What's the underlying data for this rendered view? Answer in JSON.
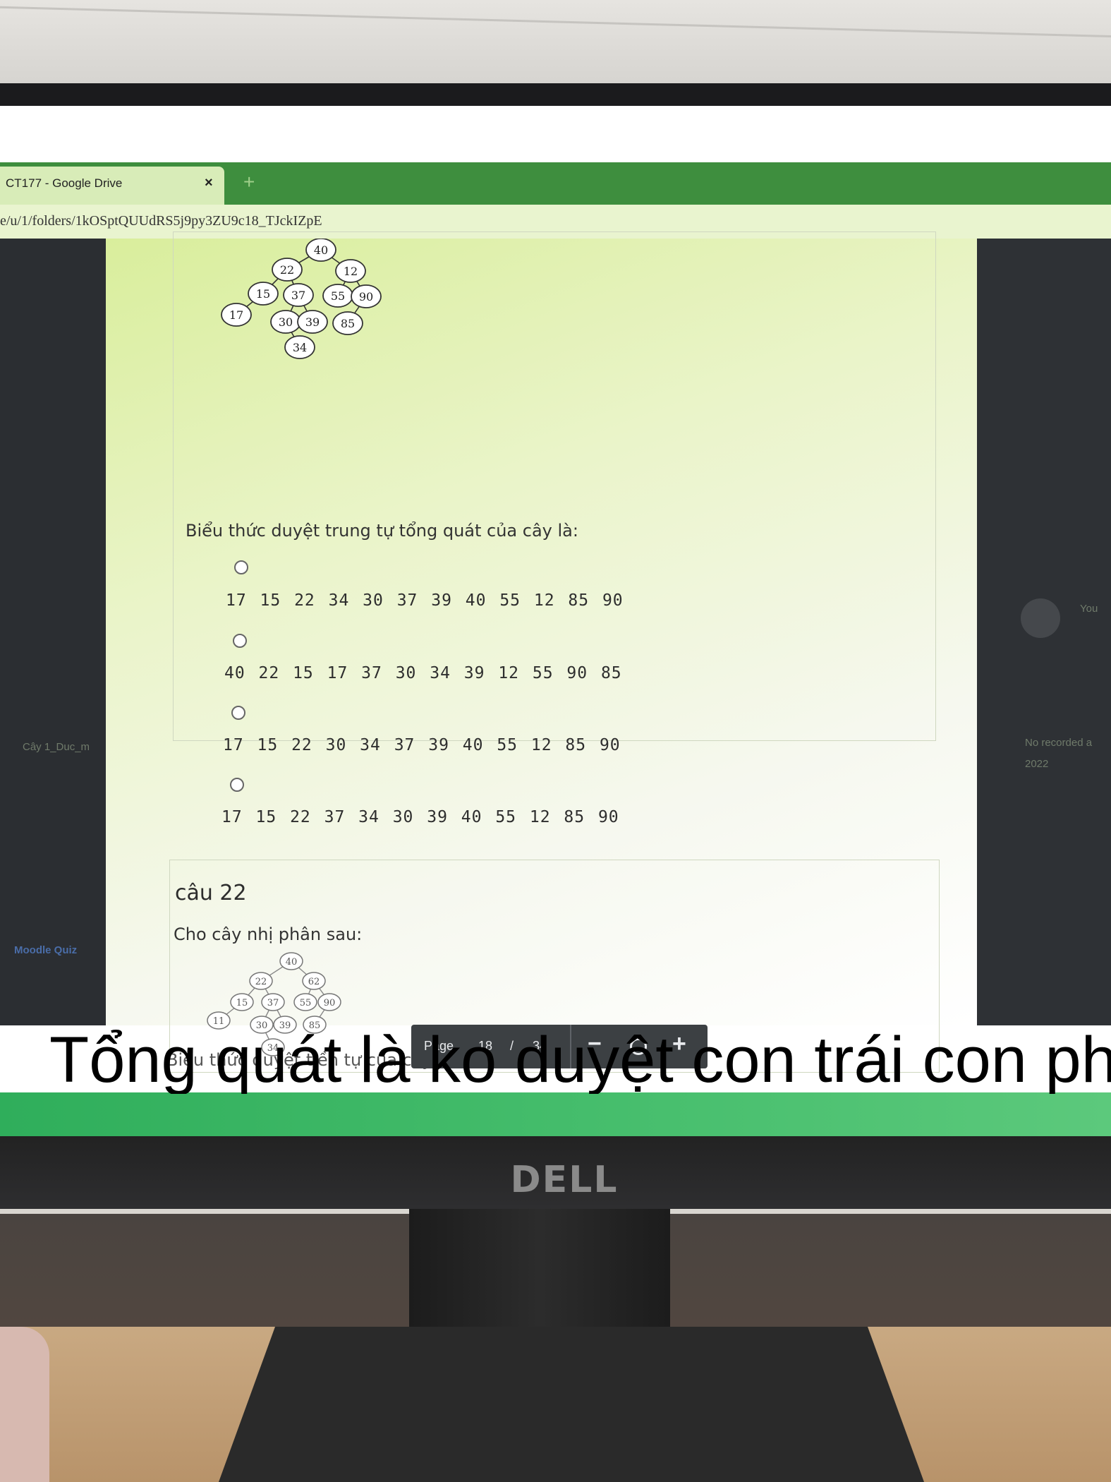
{
  "browser": {
    "tab_title": "CT177 - Google Drive",
    "tab_close": "×",
    "new_tab": "+",
    "url": "e/u/1/folders/1kOSptQUUdRS5j9py3ZU9c18_TJckIZpE"
  },
  "left_panel": {
    "item_label": "Cây 1_Duc_m",
    "link_label": "Moodle Quiz"
  },
  "right_panel": {
    "line1": "No recorded a",
    "line2": "2022",
    "you_label": "You"
  },
  "question21": {
    "tree_nodes": [
      "40",
      "22",
      "12",
      "15",
      "37",
      "55",
      "90",
      "17",
      "30",
      "39",
      "85",
      "34"
    ],
    "prompt": "Biểu thức duyệt trung tự tổng quát của cây là:",
    "options": [
      "17 15 22  34 30 37 39 40 55 12 85 90",
      "40 22 15 17  37 30 34 39 12 55 90 85",
      "17 15 22  30 34 37 39 40 55 12 85 90",
      "17 15 22  37 34 30 39 40 55 12 85 90"
    ]
  },
  "question22": {
    "title": "câu 22",
    "intro": "Cho cây nhị phân sau:",
    "tree_nodes": [
      "40",
      "22",
      "62",
      "15",
      "37",
      "55",
      "90",
      "11",
      "30",
      "39",
      "85",
      "34"
    ],
    "prompt": "Biểu thức duyệt tiền tự của cây là:"
  },
  "toolbar": {
    "page_label": "Page",
    "page_current": "18",
    "page_sep": "/",
    "page_total": "34",
    "zoom_out": "−",
    "zoom_in": "+"
  },
  "monitor": {
    "brand": "DELL"
  },
  "caption": "Tổng quát là ko duyệt con trái con ph"
}
